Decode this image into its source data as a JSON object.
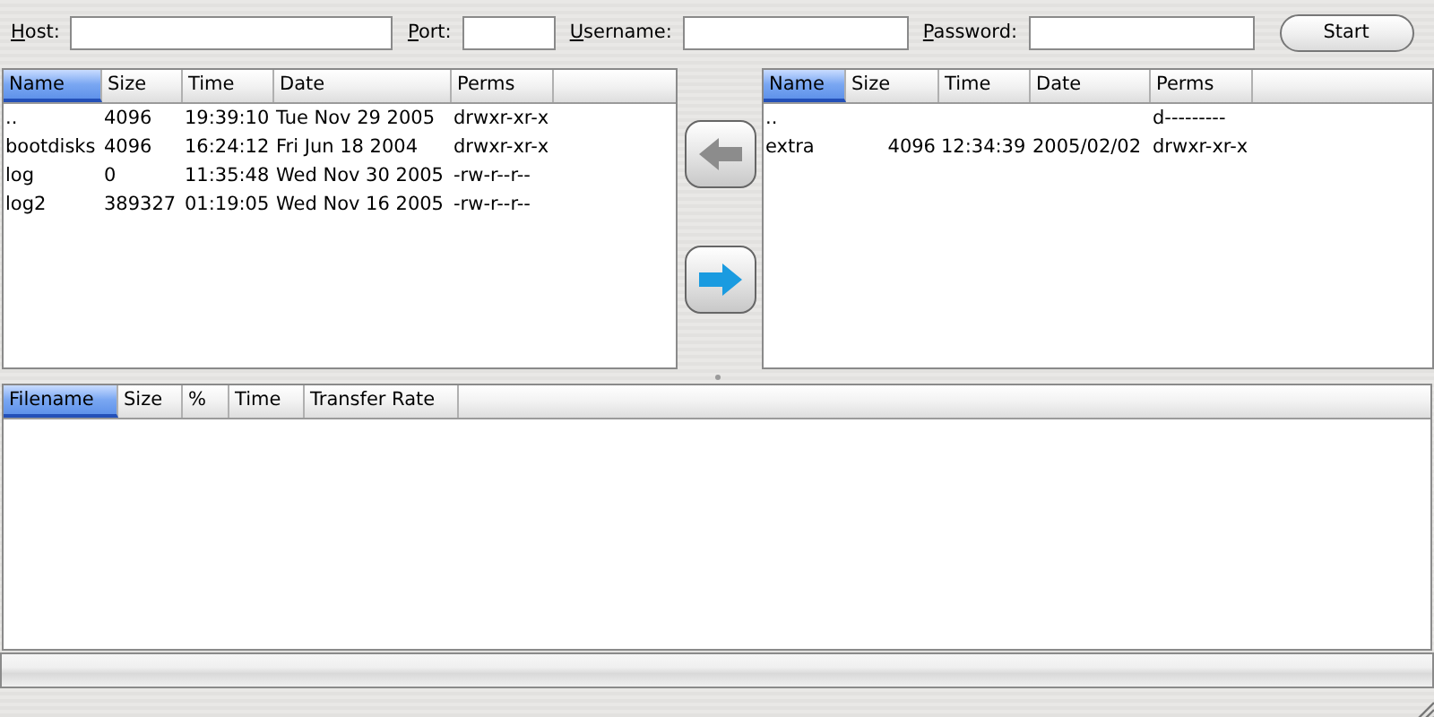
{
  "connection": {
    "fields": [
      {
        "mnemonic": "H",
        "rest": "ost:",
        "kind": "wide"
      },
      {
        "mnemonic": "P",
        "rest": "ort:",
        "kind": "narrow"
      },
      {
        "mnemonic": "U",
        "rest": "sername:",
        "kind": "medium"
      },
      {
        "mnemonic": "P",
        "rest": "assword:",
        "kind": "medium"
      }
    ],
    "start_button": "Start"
  },
  "local_files": {
    "columns": [
      {
        "label": "Name",
        "selected": true
      },
      {
        "label": "Size",
        "selected": false
      },
      {
        "label": "Time",
        "selected": false
      },
      {
        "label": "Date",
        "selected": false
      },
      {
        "label": "Perms",
        "selected": false
      }
    ],
    "rows": [
      [
        "..",
        "4096",
        "19:39:10",
        "Tue Nov 29 2005",
        "drwxr-xr-x"
      ],
      [
        "bootdisks",
        "4096",
        "16:24:12",
        "Fri Jun 18 2004",
        "drwxr-xr-x"
      ],
      [
        "log",
        "0",
        "11:35:48",
        "Wed Nov 30 2005",
        "-rw-r--r--"
      ],
      [
        "log2",
        "389327",
        "01:19:05",
        "Wed Nov 16 2005",
        "-rw-r--r--"
      ]
    ]
  },
  "transfer_buttons": [
    {
      "kind": "left",
      "disabled": true
    },
    {
      "kind": "right",
      "disabled": false
    }
  ],
  "remote_files": {
    "columns": [
      {
        "label": "Name",
        "selected": true
      },
      {
        "label": "Size",
        "selected": false
      },
      {
        "label": "Time",
        "selected": false
      },
      {
        "label": "Date",
        "selected": false
      },
      {
        "label": "Perms",
        "selected": false
      }
    ],
    "rows": [
      [
        "..",
        "",
        "",
        "",
        "d---------"
      ],
      [
        "extra",
        "4096",
        "12:34:39",
        "2005/02/02",
        "drwxr-xr-x"
      ]
    ]
  },
  "transfers": {
    "columns": [
      {
        "label": "Filename",
        "selected": true
      },
      {
        "label": "Size",
        "selected": false
      },
      {
        "label": "%",
        "selected": false
      },
      {
        "label": "Time",
        "selected": false
      },
      {
        "label": "Transfer Rate",
        "selected": false
      }
    ]
  },
  "progress": {
    "level": 0
  }
}
